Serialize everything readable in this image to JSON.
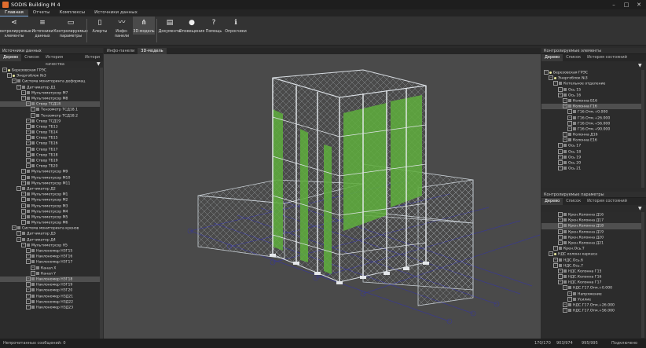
{
  "app": {
    "title": "SODIS Building M 4"
  },
  "menu": {
    "tabs": [
      "Главная",
      "Отчеты",
      "Комплексы",
      "Источники данных"
    ],
    "active": 0
  },
  "ribbon": [
    {
      "label": "Контролируемые\nэлементы",
      "icon": "share-icon"
    },
    {
      "label": "Источники\nданных",
      "icon": "server-icon"
    },
    {
      "label": "Контролируемые\nпараметры",
      "icon": "monitor-icon"
    },
    {
      "label": "Алерты",
      "icon": "trash-icon"
    },
    {
      "label": "Инфо-панели",
      "icon": "trend-icon"
    },
    {
      "label": "3D-модель",
      "icon": "graph-icon"
    },
    {
      "label": "Документы",
      "icon": "document-icon"
    },
    {
      "label": "Оповещения",
      "icon": "alert-icon"
    },
    {
      "label": "Помощь",
      "icon": "help-icon"
    },
    {
      "label": "Опросчики",
      "icon": "info-icon"
    }
  ],
  "left_panel": {
    "title": "Источники данных",
    "tabs": [
      "Дерево",
      "Список",
      "История качества данных",
      "Истори"
    ],
    "rows": [
      {
        "t": "Березовская ГРЭС",
        "d": 0
      },
      {
        "t": "Энергоблок №3",
        "d": 1
      },
      {
        "t": "Система мониторинга деформац",
        "d": 2
      },
      {
        "t": "Датчикатор Д1",
        "d": 3
      },
      {
        "t": "Мультиметрсор М7",
        "d": 4
      },
      {
        "t": "Мультиметрсор М8",
        "d": 4
      },
      {
        "t": "Створ ТСД18",
        "d": 5,
        "hl": true
      },
      {
        "t": "Тензометр ТСД18.1",
        "d": 6
      },
      {
        "t": "Тензометр ТСД18.2",
        "d": 6
      },
      {
        "t": "Створ ТСД19",
        "d": 5
      },
      {
        "t": "Створ ТБ13",
        "d": 5
      },
      {
        "t": "Створ ТБ14",
        "d": 5
      },
      {
        "t": "Створ ТБ15",
        "d": 5
      },
      {
        "t": "Створ ТБ16",
        "d": 5
      },
      {
        "t": "Створ ТБ17",
        "d": 5
      },
      {
        "t": "Створ ТБ18",
        "d": 5
      },
      {
        "t": "Створ ТБ19",
        "d": 5
      },
      {
        "t": "Створ ТБ20",
        "d": 5
      },
      {
        "t": "Мультиметрсор М9",
        "d": 4
      },
      {
        "t": "Мультиметрсор М10",
        "d": 4
      },
      {
        "t": "Мультиметрсор М11",
        "d": 4
      },
      {
        "t": "Датчикатор Д2",
        "d": 3
      },
      {
        "t": "Мультиметрсор М1",
        "d": 4
      },
      {
        "t": "Мультиметрсор М2",
        "d": 4
      },
      {
        "t": "Мультиметрсор М3",
        "d": 4
      },
      {
        "t": "Мультиметрсор М4",
        "d": 4
      },
      {
        "t": "Мультиметрсор М5",
        "d": 4
      },
      {
        "t": "Мультиметрсор М6",
        "d": 4
      },
      {
        "t": "Система мониторинга кренов",
        "d": 2
      },
      {
        "t": "Датчикатор Д3",
        "d": 3
      },
      {
        "t": "Датчикатор Д4",
        "d": 3
      },
      {
        "t": "Мультиметрсор Н5",
        "d": 4
      },
      {
        "t": "Наклономер НЗГ15",
        "d": 5
      },
      {
        "t": "Наклономер НЗГ16",
        "d": 5
      },
      {
        "t": "Наклономер НЗГ17",
        "d": 5
      },
      {
        "t": "Канал X",
        "d": 6
      },
      {
        "t": "Канал Y",
        "d": 6
      },
      {
        "t": "Наклономер НЗГ18",
        "d": 5,
        "hl": true
      },
      {
        "t": "Наклономер НЗГ19",
        "d": 5
      },
      {
        "t": "Наклономер НЗГ20",
        "d": 5
      },
      {
        "t": "Наклономер НЗД21",
        "d": 5
      },
      {
        "t": "Наклономер НЗД22",
        "d": 5
      },
      {
        "t": "Наклономер НЗД23",
        "d": 5
      }
    ]
  },
  "center": {
    "tabs": [
      "Инфо-панели",
      "3D-модель"
    ],
    "active": 1
  },
  "right_top": {
    "title": "Контролируемые элементы",
    "tabs": [
      "Дерево",
      "Список",
      "История состояний"
    ],
    "rows": [
      {
        "t": "Березовская ГРЭС",
        "d": 0
      },
      {
        "t": "Энергоблок №3",
        "d": 1
      },
      {
        "t": "Котельное отделение",
        "d": 2
      },
      {
        "t": "Ось 15",
        "d": 3
      },
      {
        "t": "Ось 16",
        "d": 3
      },
      {
        "t": "Колонна Б16",
        "d": 4
      },
      {
        "t": "Колонна Г16",
        "d": 4,
        "hl": true
      },
      {
        "t": "Г16.Отм.+0.000",
        "d": 5
      },
      {
        "t": "Г16.Отм.+26.000",
        "d": 5
      },
      {
        "t": "Г16.Отм.+56.000",
        "d": 5
      },
      {
        "t": "Г16.Отм.+90.000",
        "d": 5
      },
      {
        "t": "Колонна Д16",
        "d": 4
      },
      {
        "t": "Колонна Е16",
        "d": 4
      },
      {
        "t": "Ось 17",
        "d": 3
      },
      {
        "t": "Ось 18",
        "d": 3
      },
      {
        "t": "Ось 19",
        "d": 3
      },
      {
        "t": "Ось 20",
        "d": 3
      },
      {
        "t": "Ось 21",
        "d": 3
      }
    ]
  },
  "right_bottom": {
    "title": "Контролируемые параметры",
    "tabs": [
      "Дерево",
      "Список",
      "История состояний"
    ],
    "rows": [
      {
        "t": "Крен.Колонна Д16",
        "d": 3
      },
      {
        "t": "Крен.Колонна Д17",
        "d": 3
      },
      {
        "t": "Крен.Колонна Д18",
        "d": 3,
        "hl": true
      },
      {
        "t": "Крен.Колонна Д19",
        "d": 3
      },
      {
        "t": "Крен.Колонна Д20",
        "d": 3
      },
      {
        "t": "Крен.Колонна Д21",
        "d": 3
      },
      {
        "t": "Крен.Ось.Т",
        "d": 2
      },
      {
        "t": "НДС колонн каркаса",
        "d": 1
      },
      {
        "t": "НДС.Ось.6",
        "d": 2
      },
      {
        "t": "НДС.Ось.7",
        "d": 2
      },
      {
        "t": "НДС.Колонна Г15",
        "d": 3
      },
      {
        "t": "НДС.Колонна Г16",
        "d": 3
      },
      {
        "t": "НДС.Колонна Г17",
        "d": 3
      },
      {
        "t": "НДС.Г17.Отм.+0.000",
        "d": 4
      },
      {
        "t": "Напряжение",
        "d": 5
      },
      {
        "t": "Усилие",
        "d": 5
      },
      {
        "t": "НДС.Г17.Отм.+26.000",
        "d": 4
      },
      {
        "t": "НДС.Г17.Отм.+56.000",
        "d": 4
      }
    ]
  },
  "status": {
    "left": "Непрочитанных сообщений: 0",
    "counts": [
      "170/170",
      "903/974",
      "995/995"
    ],
    "right": "Подключено"
  }
}
